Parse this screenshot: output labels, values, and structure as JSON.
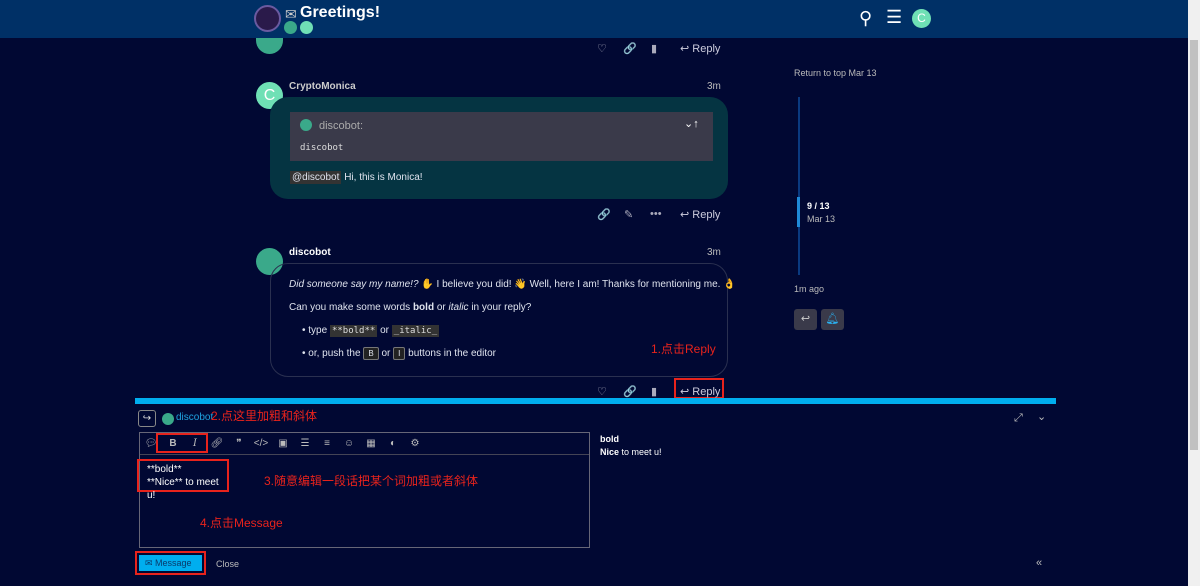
{
  "header": {
    "title": "Greetings!",
    "avatar_letter": "C"
  },
  "posts": [
    {
      "actions": {
        "reply": "Reply"
      }
    },
    {
      "author": "CryptoMonica",
      "avatar_letter": "C",
      "time": "3m",
      "quote": {
        "author": "discobot:",
        "text": "discobot"
      },
      "mention": "@discobot",
      "body": "Hi,  this is Monica!",
      "actions": {
        "reply": "Reply"
      }
    },
    {
      "author": "discobot",
      "time": "3m",
      "line1_italic": "Did someone say my name!?",
      "line1_rest": "✋ I believe you did! 👋 Well, here I am! Thanks for mentioning me. 👌",
      "line2_a": "Can you make some words",
      "line2_bold": "bold",
      "line2_or": "or",
      "line2_italic": "italic",
      "line2_b": "in your reply?",
      "bullet1_a": "type",
      "bullet1_code1": "**bold**",
      "bullet1_or": "or",
      "bullet1_code2": "_italic_",
      "bullet2_a": "or, push the",
      "bullet2_k1": "B",
      "bullet2_or": "or",
      "bullet2_k2": "I",
      "bullet2_b": "buttons in the editor",
      "actions": {
        "reply": "Reply"
      }
    }
  ],
  "timeline": {
    "top": "Return to top Mar 13",
    "position": "9 / 13",
    "date": "Mar 13",
    "bottom": "1m ago",
    "progress": 0.69
  },
  "composer": {
    "recipient": "discobot",
    "editor_lines": [
      "**bold**",
      "**Nice** to meet u!"
    ],
    "preview_line1": "bold",
    "preview_bold": "Nice",
    "preview_rest": " to meet u!",
    "submit": "Message",
    "close": "Close"
  },
  "annotations": {
    "step1": "1.点击Reply",
    "step2": "2.点这里加粗和斜体",
    "step3": "3.随意编辑一段话把某个词加粗或者斜体",
    "step4": "4.点击Message"
  },
  "colors": {
    "accent": "#00aeef",
    "annotation": "#e8231c"
  }
}
